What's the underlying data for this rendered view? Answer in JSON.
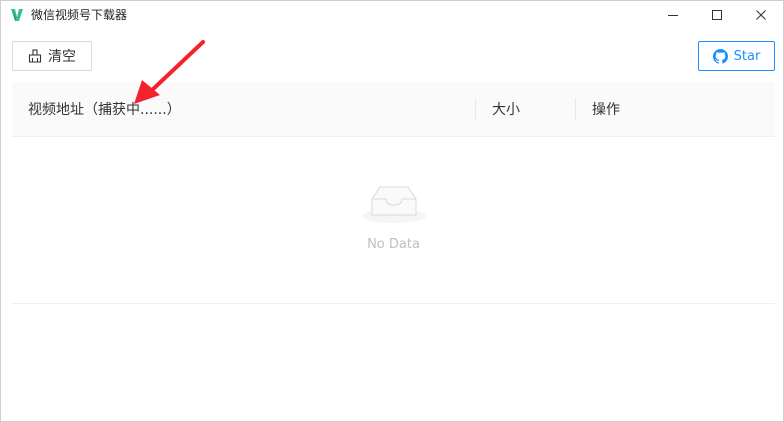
{
  "window": {
    "title": "微信视频号下载器",
    "icon": "app-logo-icon",
    "controls": [
      "minimize-icon",
      "maximize-icon",
      "close-icon"
    ]
  },
  "toolbar": {
    "clear_label": "清空",
    "clear_icon": "broom-icon",
    "star_label": "Star",
    "star_icon": "github-icon"
  },
  "table": {
    "columns": [
      "视频地址（捕获中......）",
      "大小",
      "操作"
    ],
    "empty_text": "No Data"
  },
  "colors": {
    "accent": "#1890ff",
    "annotation_arrow": "#f5222d",
    "header_bg": "#fafafa"
  }
}
